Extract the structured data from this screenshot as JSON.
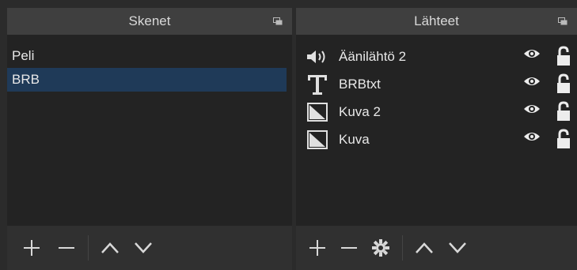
{
  "scenes_panel": {
    "title": "Skenet",
    "items": [
      {
        "label": "Peli",
        "selected": false
      },
      {
        "label": "BRB",
        "selected": true
      }
    ],
    "toolbar": [
      "add-icon",
      "remove-icon",
      "move-up-icon",
      "move-down-icon"
    ]
  },
  "sources_panel": {
    "title": "Lähteet",
    "items": [
      {
        "label": "Äänilähtö 2",
        "icon": "speaker-icon",
        "visible": true,
        "locked": false
      },
      {
        "label": "BRBtxt",
        "icon": "text-icon",
        "visible": true,
        "locked": false
      },
      {
        "label": "Kuva 2",
        "icon": "image-icon",
        "visible": true,
        "locked": false
      },
      {
        "label": "Kuva",
        "icon": "image-icon",
        "visible": true,
        "locked": false
      }
    ],
    "toolbar": [
      "add-icon",
      "remove-icon",
      "settings-icon",
      "move-up-icon",
      "move-down-icon"
    ]
  },
  "colors": {
    "selection": "#1f3a58",
    "titlebar": "#3f3f3f",
    "panel_bg": "#232323",
    "toolbar_bg": "#303030"
  }
}
